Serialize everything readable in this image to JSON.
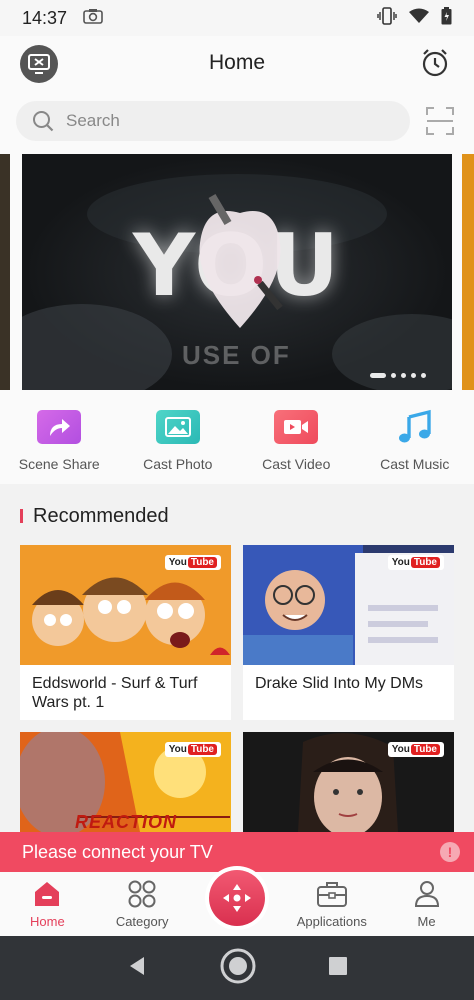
{
  "status_bar": {
    "time": "14:37",
    "icons": [
      "camera-icon",
      "vibrate-icon",
      "wifi-icon",
      "battery-icon"
    ]
  },
  "header": {
    "title": "Home",
    "left_icon": "cast-off-icon",
    "right_icon": "alarm-clock-icon"
  },
  "search": {
    "placeholder": "Search",
    "scan_icon": "scan-icon"
  },
  "banner": {
    "headline": "YOU",
    "subtext": "USE OF",
    "slide_count": 5,
    "active_slide": 1
  },
  "quick_actions": [
    {
      "label": "Scene Share",
      "icon": "share-arrow-icon",
      "color": "#c65be6"
    },
    {
      "label": "Cast Photo",
      "icon": "photo-icon",
      "color": "#3cc9c0"
    },
    {
      "label": "Cast Video",
      "icon": "video-icon",
      "color": "#f25a66"
    },
    {
      "label": "Cast Music",
      "icon": "music-note-icon",
      "color": "#3aa8e8"
    }
  ],
  "recommended": {
    "title": "Recommended",
    "accent_color": "#e43f5a",
    "cards": [
      {
        "title": "Eddsworld - Surf & Turf Wars pt. 1",
        "badge_you": "You",
        "badge_tube": "Tube"
      },
      {
        "title": "Drake Slid Into My DMs",
        "badge_you": "You",
        "badge_tube": "Tube"
      },
      {
        "title": "",
        "badge_you": "You",
        "badge_tube": "Tube",
        "overlay_text": "REACTION"
      },
      {
        "title": "",
        "badge_you": "You",
        "badge_tube": "Tube"
      }
    ]
  },
  "connect_banner": {
    "text": "Please connect your TV",
    "info_glyph": "!",
    "color": "#f04a61"
  },
  "bottom_nav": {
    "items": [
      {
        "label": "Home",
        "icon": "home-icon",
        "active": true
      },
      {
        "label": "Category",
        "icon": "category-grid-icon",
        "active": false
      },
      {
        "label": "",
        "icon": "remote-dpad-icon",
        "active": false
      },
      {
        "label": "Applications",
        "icon": "briefcase-icon",
        "active": false
      },
      {
        "label": "Me",
        "icon": "person-icon",
        "active": false
      }
    ]
  },
  "system_nav": {
    "icons": [
      "back-icon",
      "home-circle-icon",
      "recents-icon"
    ]
  }
}
